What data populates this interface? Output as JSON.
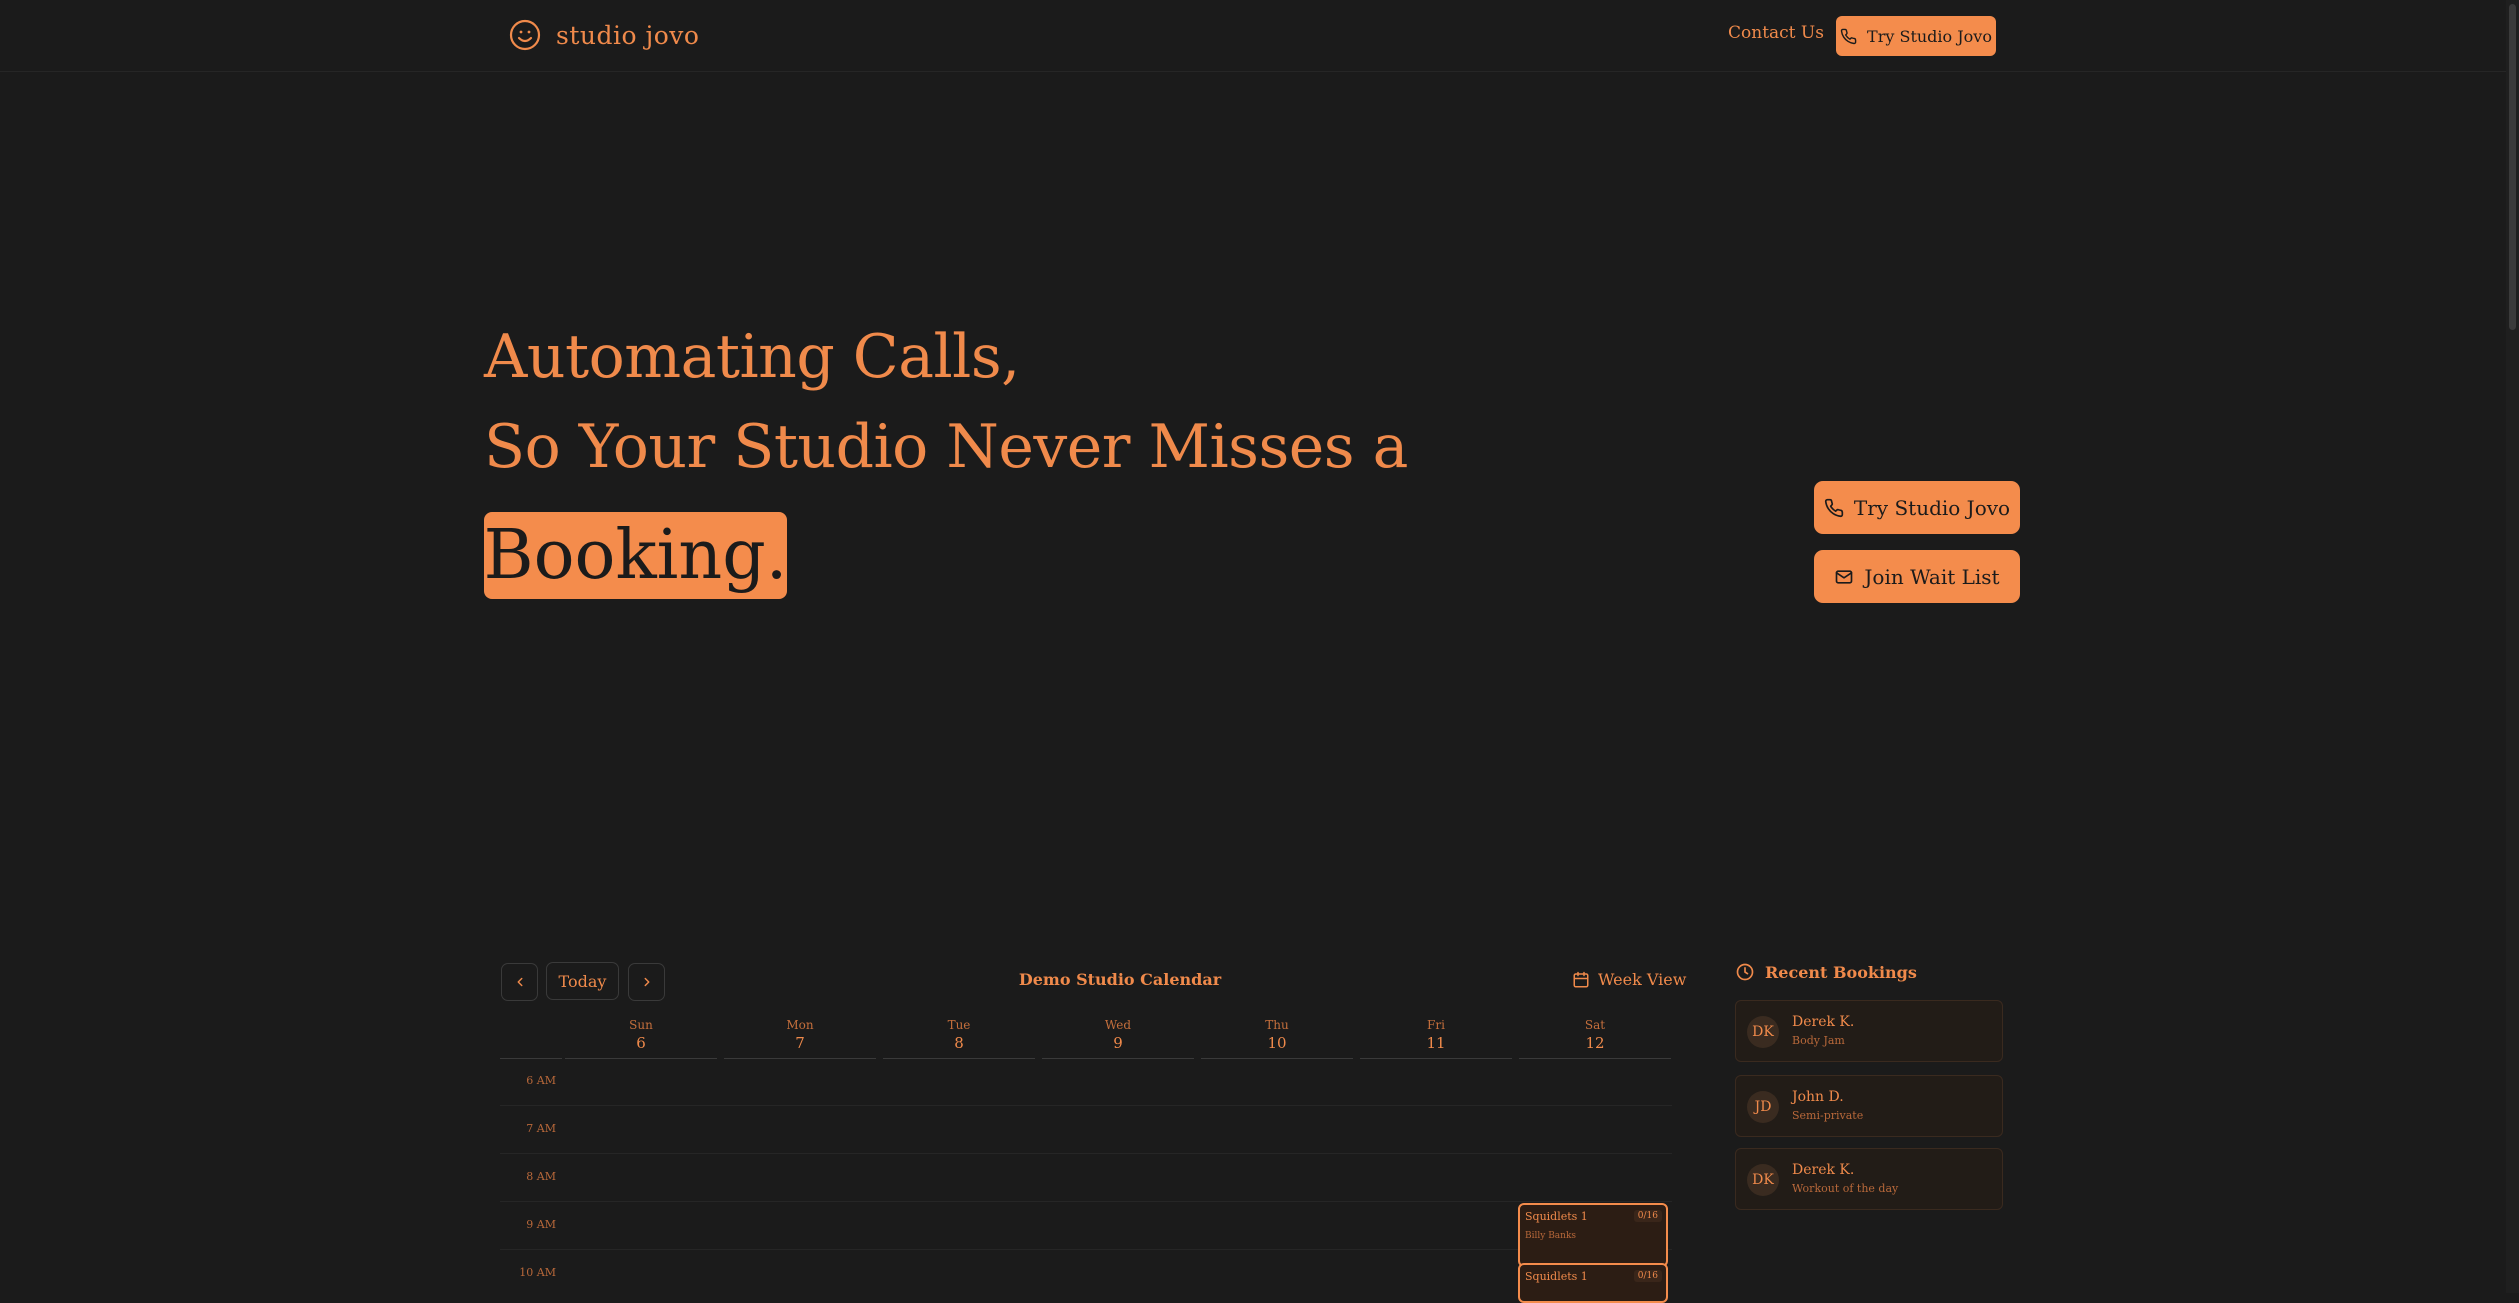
{
  "nav": {
    "brand": "studio jovo",
    "contact": "Contact Us",
    "cta": "Try Studio Jovo"
  },
  "hero": {
    "line1": "Automating Calls,",
    "line2": "So Your Studio Never Misses a",
    "highlight": "Booking.",
    "primary_cta": "Try Studio Jovo",
    "secondary_cta": "Join Wait List"
  },
  "calendar": {
    "today": "Today",
    "title": "Demo Studio Calendar",
    "view": "Week View",
    "days": [
      {
        "name": "Sun",
        "num": "6"
      },
      {
        "name": "Mon",
        "num": "7"
      },
      {
        "name": "Tue",
        "num": "8"
      },
      {
        "name": "Wed",
        "num": "9"
      },
      {
        "name": "Thu",
        "num": "10"
      },
      {
        "name": "Fri",
        "num": "11"
      },
      {
        "name": "Sat",
        "num": "12"
      }
    ],
    "times": [
      "6 AM",
      "7 AM",
      "8 AM",
      "9 AM",
      "10 AM"
    ],
    "events": [
      {
        "title": "Squidlets 1",
        "instructor": "Billy Banks",
        "capacity": "0/16"
      },
      {
        "title": "Squidlets 1",
        "capacity": "0/16"
      }
    ]
  },
  "recent_bookings": {
    "title": "Recent Bookings",
    "items": [
      {
        "initials": "DK",
        "name": "Derek K.",
        "class": "Body Jam"
      },
      {
        "initials": "JD",
        "name": "John D.",
        "class": "Semi-private"
      },
      {
        "initials": "DK",
        "name": "Derek K.",
        "class": "Workout of the day"
      }
    ]
  },
  "colors": {
    "accent": "#f48c4c",
    "background": "#1b1b1b",
    "text_accent": "#f08a4b"
  }
}
